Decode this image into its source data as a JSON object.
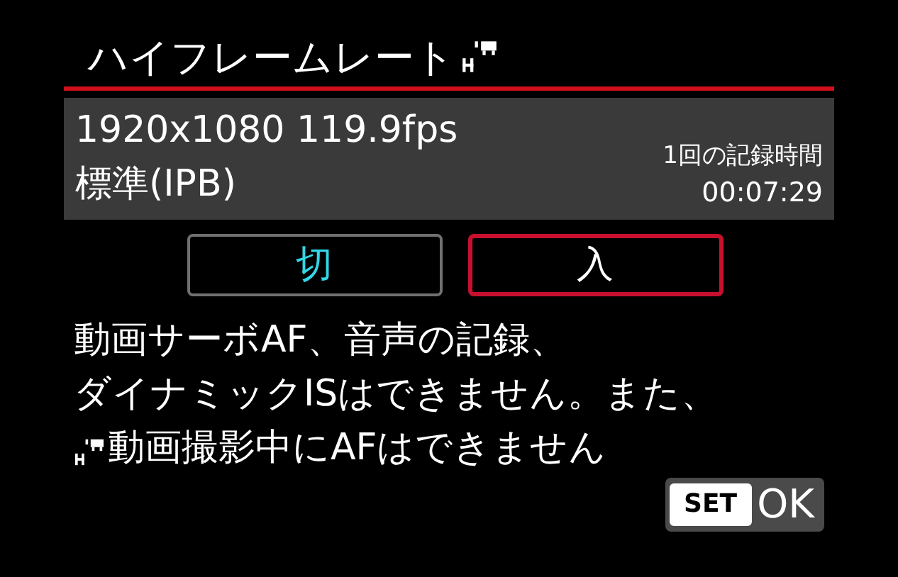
{
  "title": "ハイフレームレート",
  "info": {
    "format": "1920x1080 119.9fps",
    "compression": "標準(IPB)",
    "time_label": "1回の記録時間",
    "time_value": "00:07:29"
  },
  "options": [
    {
      "label": "切",
      "selected": false,
      "current": true
    },
    {
      "label": "入",
      "selected": true,
      "current": false
    }
  ],
  "notice": [
    "動画サーボAF、音声の記録、",
    "ダイナミックISはできません。また、",
    "動画撮影中にAFはできません"
  ],
  "ok_button": {
    "key": "SET",
    "label": "OK"
  }
}
